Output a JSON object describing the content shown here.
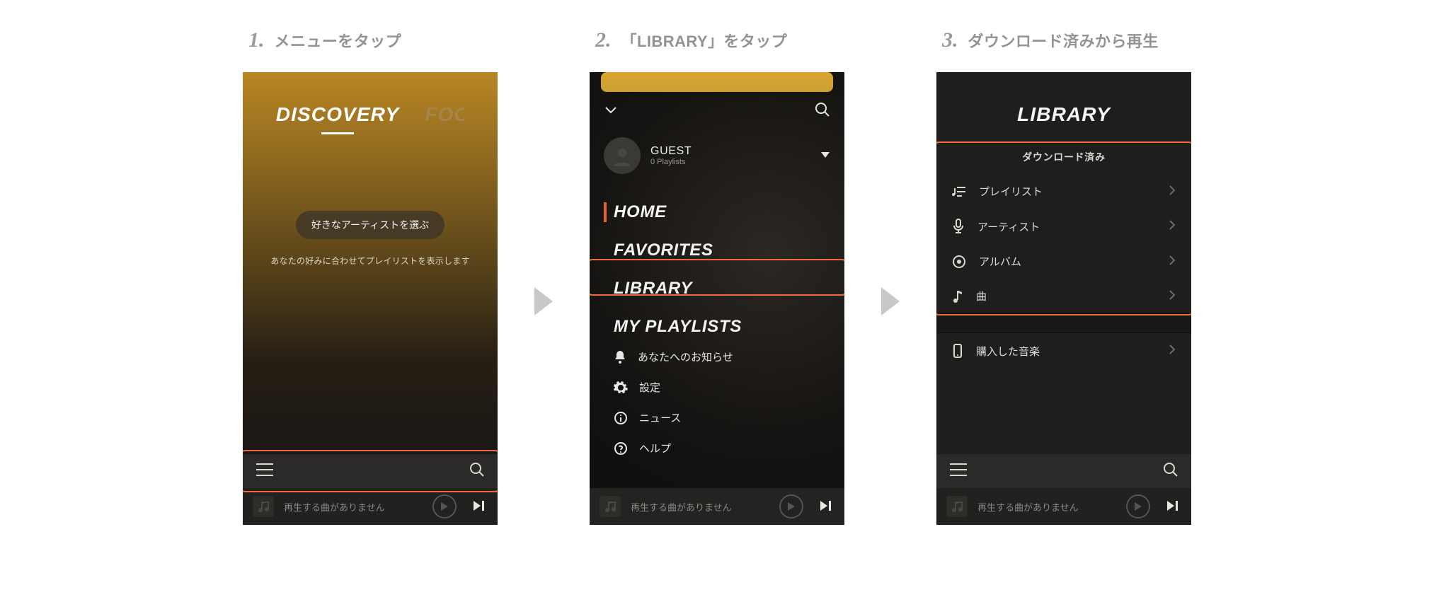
{
  "steps": {
    "s1": {
      "num": "1.",
      "caption": "メニューをタップ"
    },
    "s2": {
      "num": "2.",
      "caption": "「LIBRARY」をタップ"
    },
    "s3": {
      "num": "3.",
      "caption": "ダウンロード済みから再生"
    }
  },
  "screen1": {
    "tab_active": "DISCOVERY",
    "tab_secondary": "FOCUS",
    "chip": "好きなアーティストを選ぶ",
    "subtitle": "あなたの好みに合わせてプレイリストを表示します",
    "now_playing": "再生する曲がありません"
  },
  "screen2": {
    "user_name": "GUEST",
    "user_sub": "0 Playlists",
    "nav": {
      "home": "HOME",
      "favorites": "FAVORITES",
      "library": "LIBRARY",
      "myplaylists": "MY PLAYLISTS"
    },
    "sub": {
      "notice": "あなたへのお知らせ",
      "settings": "設定",
      "news": "ニュース",
      "help": "ヘルプ"
    },
    "now_playing": "再生する曲がありません"
  },
  "screen3": {
    "title": "LIBRARY",
    "section": "ダウンロード済み",
    "items": {
      "playlist": "プレイリスト",
      "artist": "アーティスト",
      "album": "アルバム",
      "song": "曲"
    },
    "purchased": "購入した音楽",
    "now_playing": "再生する曲がありません"
  }
}
